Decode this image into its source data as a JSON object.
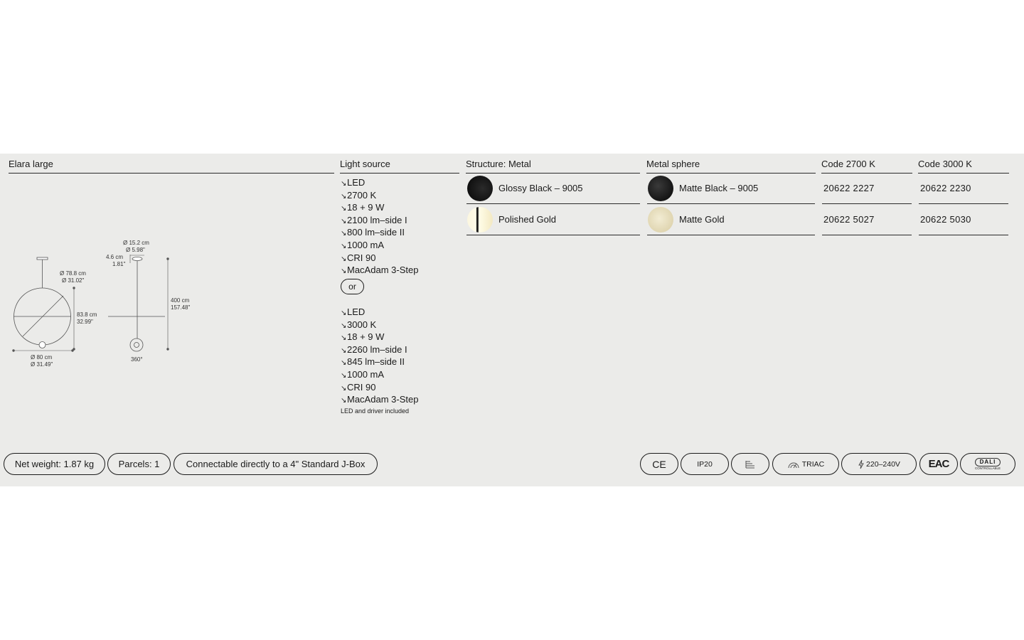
{
  "product": {
    "name": "Elara large"
  },
  "headers": {
    "light_source": "Light source",
    "structure": "Structure: Metal",
    "sphere": "Metal sphere",
    "code_2700": "Code 2700 K",
    "code_3000": "Code 3000 K"
  },
  "light_source": {
    "arrow": "↘",
    "option_a": [
      "LED",
      "2700 K",
      "18 + 9 W",
      "2100 lm–side I",
      "800 lm–side II",
      "1000 mA",
      "CRI 90",
      "MacAdam 3-Step"
    ],
    "or_label": "or",
    "option_b": [
      "LED",
      "3000 K",
      "18 + 9 W",
      "2260 lm–side I",
      "845 lm–side II",
      "1000 mA",
      "CRI 90",
      "MacAdam 3-Step"
    ],
    "note": "LED and driver included"
  },
  "finishes": [
    {
      "structure": "Glossy Black – 9005",
      "sphere": "Matte Black – 9005",
      "code_2700": "20622  2227",
      "code_3000": "20622  2230"
    },
    {
      "structure": "Polished Gold",
      "sphere": "Matte Gold",
      "code_2700": "20622  5027",
      "code_3000": "20622  5030"
    }
  ],
  "dimensions": {
    "sphere_diameter_cm": "Ø 78.8 cm",
    "sphere_diameter_in": "Ø 31.02\"",
    "height_cm": "83.8 cm",
    "height_in": "32.99\"",
    "width_cm": "Ø 80 cm",
    "width_in": "Ø 31.49\"",
    "canopy_cm": "Ø 15.2 cm",
    "canopy_in": "Ø 5.98\"",
    "canopy_h_cm": "4.6 cm",
    "canopy_h_in": "1.81\"",
    "total_cm": "400 cm",
    "total_in": "157.48\"",
    "rotation": "360°"
  },
  "footer": {
    "net_weight": "Net weight: 1.87 kg",
    "parcels": "Parcels: 1",
    "jbox": "Connectable directly to a 4\" Standard J-Box"
  },
  "certifications": {
    "ce": "CE",
    "ip": "IP20",
    "triac": "TRIAC",
    "voltage": "220–240V",
    "eac": "EAC",
    "dali": "DALI",
    "dali_sub": "CONTROLLABLE"
  },
  "colors": {
    "panel": "#ebebe9",
    "ink": "#1a1a1a"
  }
}
